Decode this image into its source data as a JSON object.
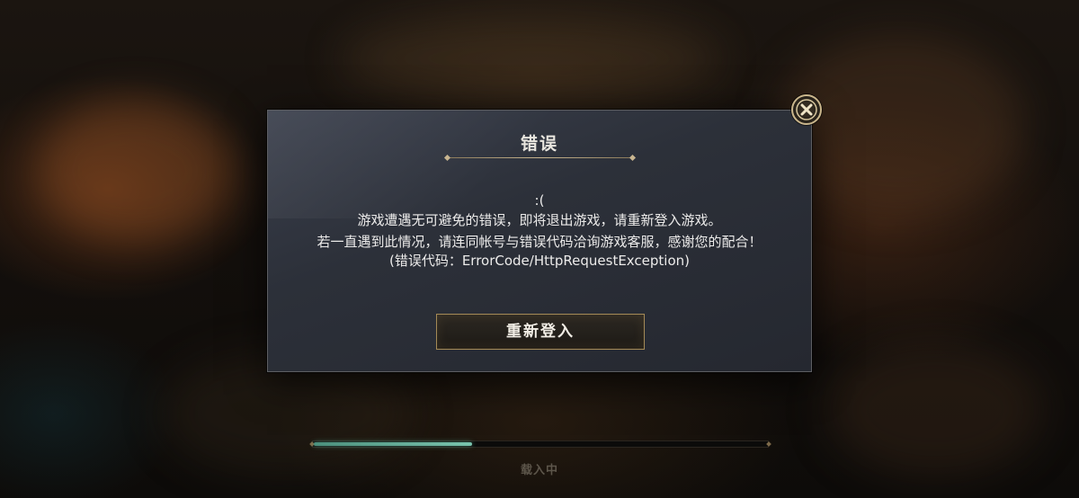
{
  "dialog": {
    "title": "错误",
    "face": ":(",
    "line1": "游戏遭遇无可避免的错误，即将退出游戏，请重新登入游戏。",
    "line2": "若一直遇到此情况，请连同帐号与错误代码洽询游戏客服，感谢您的配合！",
    "line3": "(错误代码：ErrorCode/HttpRequestException)",
    "relogin_label": "重新登入",
    "close_icon": "close-x-icon"
  },
  "loading": {
    "label": "载入中",
    "progress": 0.35
  },
  "colors": {
    "accent_gold": "#c9b58b",
    "progress_teal": "#79c3ad"
  }
}
